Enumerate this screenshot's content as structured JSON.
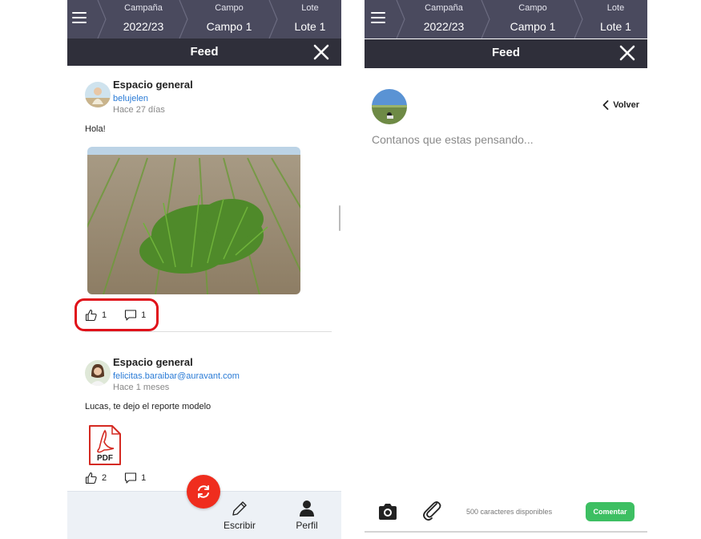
{
  "left_screen": {
    "header": {
      "crumbs": [
        {
          "label": "Campaña",
          "value": "2022/23"
        },
        {
          "label": "Campo",
          "value": "Campo 1"
        },
        {
          "label": "Lote",
          "value": "Lote 1"
        }
      ],
      "title": "Feed"
    },
    "posts": [
      {
        "space": "Espacio general",
        "user": "belujelen",
        "time": "Hace 27 días",
        "body": "Hola!",
        "likes": "1",
        "comments": "1"
      },
      {
        "space": "Espacio general",
        "user": "felicitas.baraibar@auravant.com",
        "time": "Hace 1 meses",
        "body": "Lucas, te dejo el reporte modelo",
        "attachment": "PDF",
        "likes": "2",
        "comments": "1"
      }
    ],
    "bottom_tabs": {
      "write": "Escribir",
      "profile": "Perfil"
    }
  },
  "right_screen": {
    "header": {
      "crumbs": [
        {
          "label": "Campaña",
          "value": "2022/23"
        },
        {
          "label": "Campo",
          "value": "Campo 1"
        },
        {
          "label": "Lote",
          "value": "Lote 1"
        }
      ],
      "title": "Feed"
    },
    "back_label": "Volver",
    "compose_placeholder": "Contanos que estas pensando...",
    "chars_available": "500 caracteres disponibles",
    "submit_label": "Comentar"
  },
  "colors": {
    "header_bg": "#4a4a5e",
    "feedbar_bg": "#2f2f3a",
    "link_blue": "#2a7bd6",
    "fab_red": "#ef2d1e",
    "highlight_red": "#e0121a",
    "submit_green": "#3dbf62"
  },
  "icons": [
    "menu-icon",
    "close-icon",
    "thumbs-up-icon",
    "comment-icon",
    "pdf-icon",
    "sync-icon",
    "pencil-icon",
    "person-icon",
    "chevron-left-icon",
    "camera-icon",
    "paperclip-icon"
  ]
}
